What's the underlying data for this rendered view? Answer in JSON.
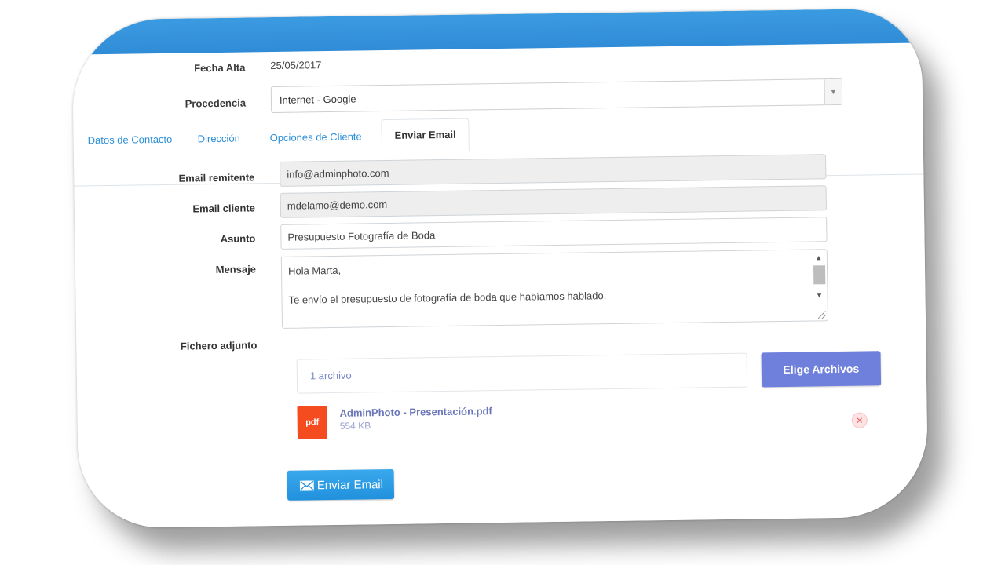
{
  "form": {
    "fecha_alta_label": "Fecha Alta",
    "fecha_alta_value": "25/05/2017",
    "procedencia_label": "Procedencia",
    "procedencia_value": "Internet - Google"
  },
  "tabs": [
    {
      "label": "Datos de Contacto"
    },
    {
      "label": "Dirección"
    },
    {
      "label": "Opciones de Cliente"
    },
    {
      "label": "Enviar Email"
    }
  ],
  "email": {
    "remitente_label": "Email remitente",
    "remitente_value": "info@adminphoto.com",
    "cliente_label": "Email cliente",
    "cliente_value": "mdelamo@demo.com",
    "asunto_label": "Asunto",
    "asunto_value": "Presupuesto Fotografía de Boda",
    "mensaje_label": "Mensaje",
    "mensaje_lines": [
      "Hola Marta,",
      "Te envío el presupuesto de fotografía de boda que habíamos hablado."
    ],
    "adjunto_label": "Fichero adjunto",
    "archivos_count": "1 archivo",
    "elige_button": "Elige Archivos",
    "file_name": "AdminPhoto - Presentación.pdf",
    "file_size": "554 KB",
    "file_type": "pdf",
    "send_button": "Enviar Email"
  },
  "colors": {
    "header": "#2f8bd6",
    "link": "#2a8fd8",
    "elige_button": "#6f7fdc",
    "send_button": "#2191dd",
    "pdf_icon": "#f44b1f"
  }
}
